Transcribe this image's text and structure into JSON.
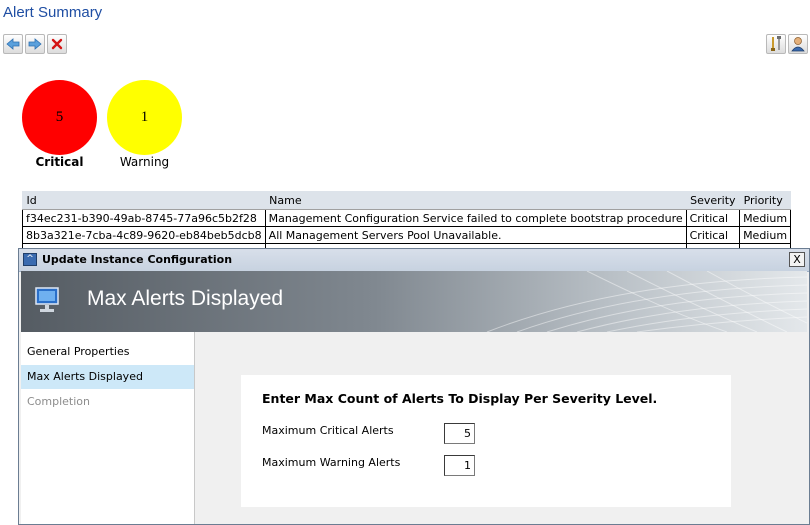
{
  "window": {
    "title": "Alert Summary"
  },
  "toolbar": {
    "back_icon": "arrow-left-icon",
    "forward_icon": "arrow-right-icon",
    "close_icon": "red-x-icon",
    "tools_icon": "tools-icon",
    "user_icon": "user-icon"
  },
  "summary": {
    "critical": {
      "count": "5",
      "label": "Critical",
      "color": "#ff0000"
    },
    "warning": {
      "count": "1",
      "label": "Warning",
      "color": "#ffff00"
    }
  },
  "alerts": {
    "columns": [
      "Id",
      "Name",
      "Severity",
      "Priority"
    ],
    "rows": [
      {
        "id": "f34ec231-b390-49ab-8745-77a96c5b2f28",
        "name": "Management Configuration Service failed to complete bootstrap procedure",
        "severity": "Critical",
        "priority": "Medium"
      },
      {
        "id": "8b3a321e-7cba-4c89-9620-eb84beb5dcb8",
        "name": "All Management Servers Pool Unavailable.",
        "severity": "Critical",
        "priority": "Medium"
      }
    ]
  },
  "dialog": {
    "title": "Update Instance Configuration",
    "close_label": "X",
    "banner_title": "Max Alerts Displayed",
    "nav": [
      "General Properties",
      "Max Alerts Displayed",
      "Completion"
    ],
    "heading": "Enter Max Count of Alerts To Display Per Severity Level.",
    "critical_label": "Maximum Critical Alerts",
    "critical_value": "5",
    "warning_label": "Maximum Warning Alerts",
    "warning_value": "1"
  }
}
